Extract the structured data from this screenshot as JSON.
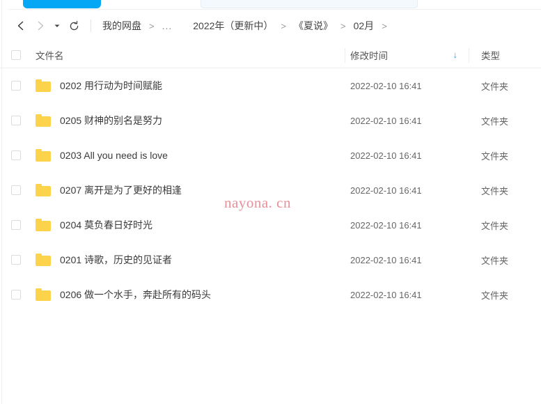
{
  "topbar": {
    "primary_button_color": "#06a7f5",
    "search_field_color": "#f3f9fd"
  },
  "nav": {
    "back_icon": "chevron-left-icon",
    "forward_icon": "chevron-right-icon",
    "history_caret_icon": "caret-down-icon",
    "refresh_icon": "refresh-icon"
  },
  "breadcrumb": {
    "separator": ">",
    "items": [
      {
        "label": "我的网盘"
      },
      {
        "label": "..."
      },
      {
        "label": "2022年（更新中）"
      },
      {
        "label": "《夏说》"
      },
      {
        "label": "02月"
      }
    ],
    "trailing_separator": ">"
  },
  "table": {
    "header": {
      "select_all_checkbox": "",
      "name": "文件名",
      "time": "修改时间",
      "type": "类型",
      "sort_arrow": "↓",
      "sort_arrow_color": "#26a2f5",
      "sort_direction": "descending"
    },
    "rows": [
      {
        "name": "0202 用行动为时间赋能",
        "time": "2022-02-10 16:41",
        "type": "文件夹",
        "icon": "folder-icon"
      },
      {
        "name": "0205 财神的别名是努力",
        "time": "2022-02-10 16:41",
        "type": "文件夹",
        "icon": "folder-icon"
      },
      {
        "name": "0203 All you need is love",
        "time": "2022-02-10 16:41",
        "type": "文件夹",
        "icon": "folder-icon"
      },
      {
        "name": "0207 离开是为了更好的相逢",
        "time": "2022-02-10 16:41",
        "type": "文件夹",
        "icon": "folder-icon"
      },
      {
        "name": "0204  莫负春日好时光",
        "time": "2022-02-10 16:41",
        "type": "文件夹",
        "icon": "folder-icon"
      },
      {
        "name": "0201 诗歌，历史的见证者",
        "time": "2022-02-10 16:41",
        "type": "文件夹",
        "icon": "folder-icon"
      },
      {
        "name": "0206 做一个水手，奔赴所有的码头",
        "time": "2022-02-10 16:41",
        "type": "文件夹",
        "icon": "folder-icon"
      }
    ]
  },
  "watermark": {
    "text": "nayona. cn",
    "color": "#e8909a"
  }
}
